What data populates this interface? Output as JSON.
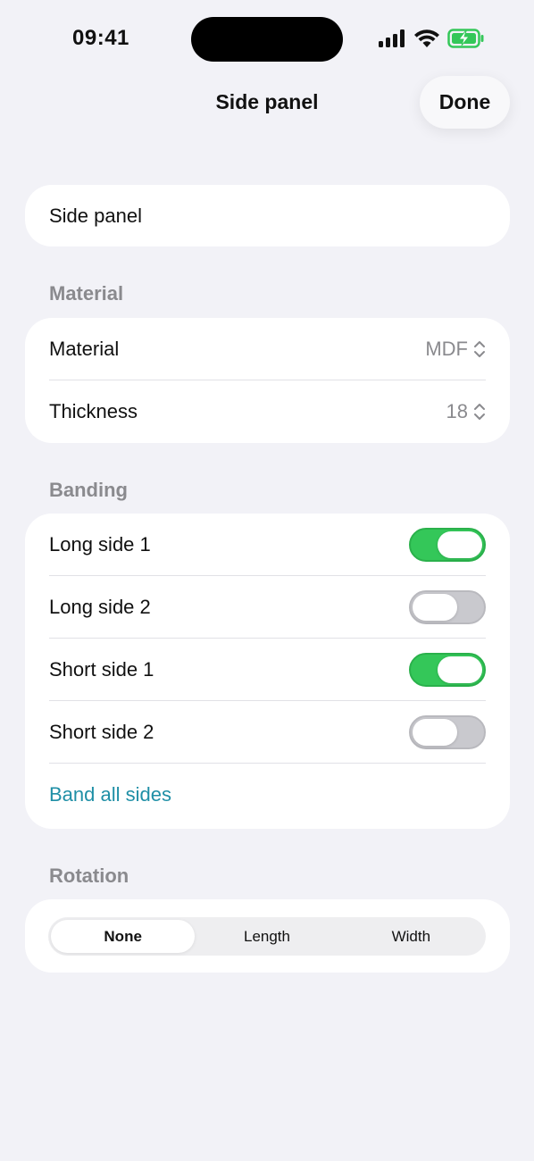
{
  "status_bar": {
    "time": "09:41"
  },
  "nav": {
    "title": "Side panel",
    "done_label": "Done"
  },
  "name_field": {
    "value": "Side panel"
  },
  "material_section": {
    "header": "Material",
    "rows": [
      {
        "label": "Material",
        "value": "MDF"
      },
      {
        "label": "Thickness",
        "value": "18"
      }
    ]
  },
  "banding_section": {
    "header": "Banding",
    "rows": [
      {
        "label": "Long side 1",
        "on": true
      },
      {
        "label": "Long side 2",
        "on": false
      },
      {
        "label": "Short side 1",
        "on": true
      },
      {
        "label": "Short side 2",
        "on": false
      }
    ],
    "band_all_label": "Band all sides"
  },
  "rotation_section": {
    "header": "Rotation",
    "options": [
      "None",
      "Length",
      "Width"
    ],
    "selected": "None"
  },
  "colors": {
    "background": "#f2f2f7",
    "toggle_on": "#34c759",
    "toggle_off": "#c9c9ce",
    "link": "#1f8fa6",
    "secondary_text": "#8a8a8e"
  },
  "icons": [
    "signal-icon",
    "wifi-icon",
    "battery-charging-icon",
    "chevron-up-down-icon"
  ]
}
